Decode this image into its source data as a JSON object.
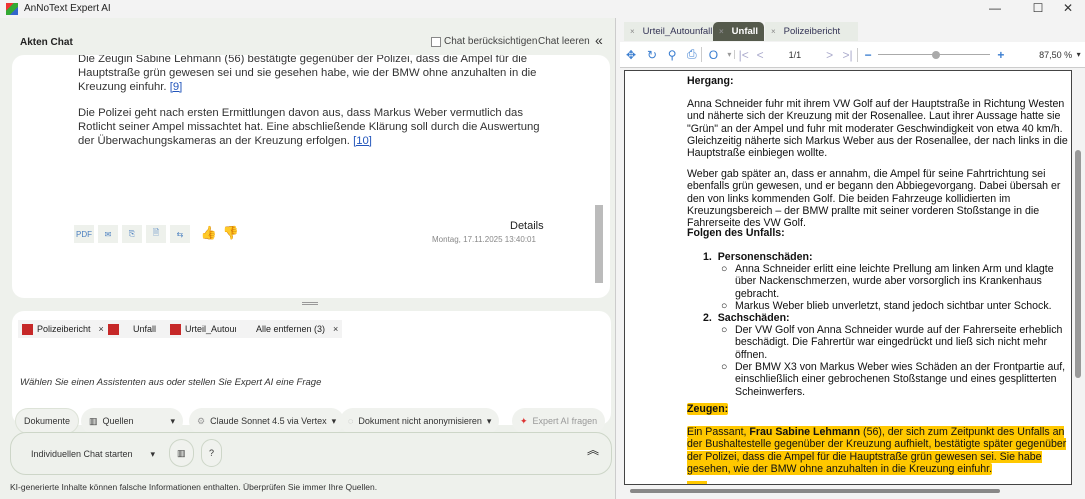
{
  "window": {
    "title": "AnNoText Expert AI",
    "minimize": "—",
    "maximize": "☐",
    "close": "✕"
  },
  "left": {
    "header": "Akten Chat",
    "consider_chat": "Chat berücksichtigen",
    "clear_chat": "Chat leeren",
    "collapse": "«",
    "message": {
      "p1": "Die Zeugin Sabine Lehmann (56) bestätigte gegenüber der Polizei, dass die Ampel für die Hauptstraße grün gewesen sei und sie gesehen habe, wie der BMW ohne anzuhalten in die Kreuzung einfuhr.",
      "ref1": "[9]",
      "p2": "Die Polizei geht nach ersten Ermittlungen davon aus, dass Markus Weber vermutlich das Rotlicht seiner Ampel missachtet hat. Eine abschließende Klärung soll durch die Auswertung der Überwachungskameras an der Kreuzung erfolgen.",
      "ref2": "[10]",
      "details": "Details",
      "date": "Montag, 17.11.2025 13:40:01",
      "actions": [
        "PDF",
        "✉",
        "⎘",
        "🗎",
        "⇆"
      ],
      "thumbs_up": "👍",
      "thumbs_down": "👎"
    },
    "chips": [
      {
        "label": "Polizeibericht"
      },
      {
        "label": "Unfall"
      },
      {
        "label": "Urteil_Autounfall"
      }
    ],
    "remove_all": "Alle entfernen  (3)",
    "x": "×",
    "prompt": "Wählen Sie einen Assistenten aus oder stellen Sie Expert AI eine Frage",
    "buttons": {
      "documents": "Dokumente",
      "sources": "Quellen",
      "model": "Claude Sonnet 4.5 via Vertex",
      "anonymize": "Dokument nicht anonymisieren",
      "ask": "Expert AI fragen",
      "caret": "▾"
    },
    "bottom": {
      "start_chat": "Individuellen Chat starten",
      "help": "?",
      "expand": "︽"
    },
    "disclaimer": "KI-generierte Inhalte können falsche Informationen enthalten. Überprüfen Sie immer Ihre Quellen."
  },
  "right": {
    "tabs": [
      {
        "label": "Urteil_Autounfall",
        "active": false
      },
      {
        "label": "Unfall",
        "active": true
      },
      {
        "label": "Polizeibericht",
        "active": false
      }
    ],
    "page": "1/1",
    "zoom": "87,50 %",
    "zoom_value_percent": 87.5,
    "doc": {
      "h1": "Hergang:",
      "p1": "Anna Schneider fuhr mit ihrem VW Golf auf der Hauptstraße in Richtung Westen und näherte sich der Kreuzung mit der Rosenallee. Laut ihrer Aussage hatte sie \"Grün\" an der Ampel und fuhr mit moderater Geschwindigkeit von etwa 40 km/h. Gleichzeitig näherte sich Markus Weber aus der Rosenallee, der nach links in die Hauptstraße einbiegen wollte.",
      "p2": "Weber gab später an, dass er annahm, die Ampel für seine Fahrtrichtung sei ebenfalls grün gewesen, und er begann den Abbiegevorgang. Dabei übersah er den von links kommenden Golf. Die beiden Fahrzeuge kollidierten im Kreuzungsbereich – der BMW prallte mit seiner vorderen Stoßstange in die Fahrerseite des VW Golf.",
      "h2": "Folgen des Unfalls:",
      "l1": "Personenschäden:",
      "l1a": "Anna Schneider erlitt eine leichte Prellung am linken Arm und klagte über Nackenschmerzen, wurde aber vorsorglich ins Krankenhaus gebracht.",
      "l1b": "Markus Weber blieb unverletzt, stand jedoch sichtbar unter Schock.",
      "l2": "Sachschäden:",
      "l2a": "Der VW Golf von Anna Schneider wurde auf der Fahrerseite erheblich beschädigt. Die Fahrertür war eingedrückt und ließ sich nicht mehr öffnen.",
      "l2b": "Der BMW X3 von Markus Weber wies Schäden an der Frontpartie auf, einschließlich einer gebrochenen Stoßstange und eines gesplitterten Scheinwerfers.",
      "h3": "Zeugen:",
      "p3a": "Ein Passant, ",
      "p3b": "Frau Sabine Lehmann",
      "p3c": " (56), der sich zum Zeitpunkt des Unfalls an der Bushaltestelle gegenüber der Kreuzung aufhielt, bestätigte später gegenüber der Polizei, dass die Ampel für die Hauptstraße grün gewesen sei. Sie habe gesehen, wie der BMW ohne anzuhalten in die Kreuzung einfuhr."
    }
  },
  "colors": {
    "highlight": "#ffc800",
    "accent": "#3b7ed0",
    "active_tab": "#555a4c"
  }
}
